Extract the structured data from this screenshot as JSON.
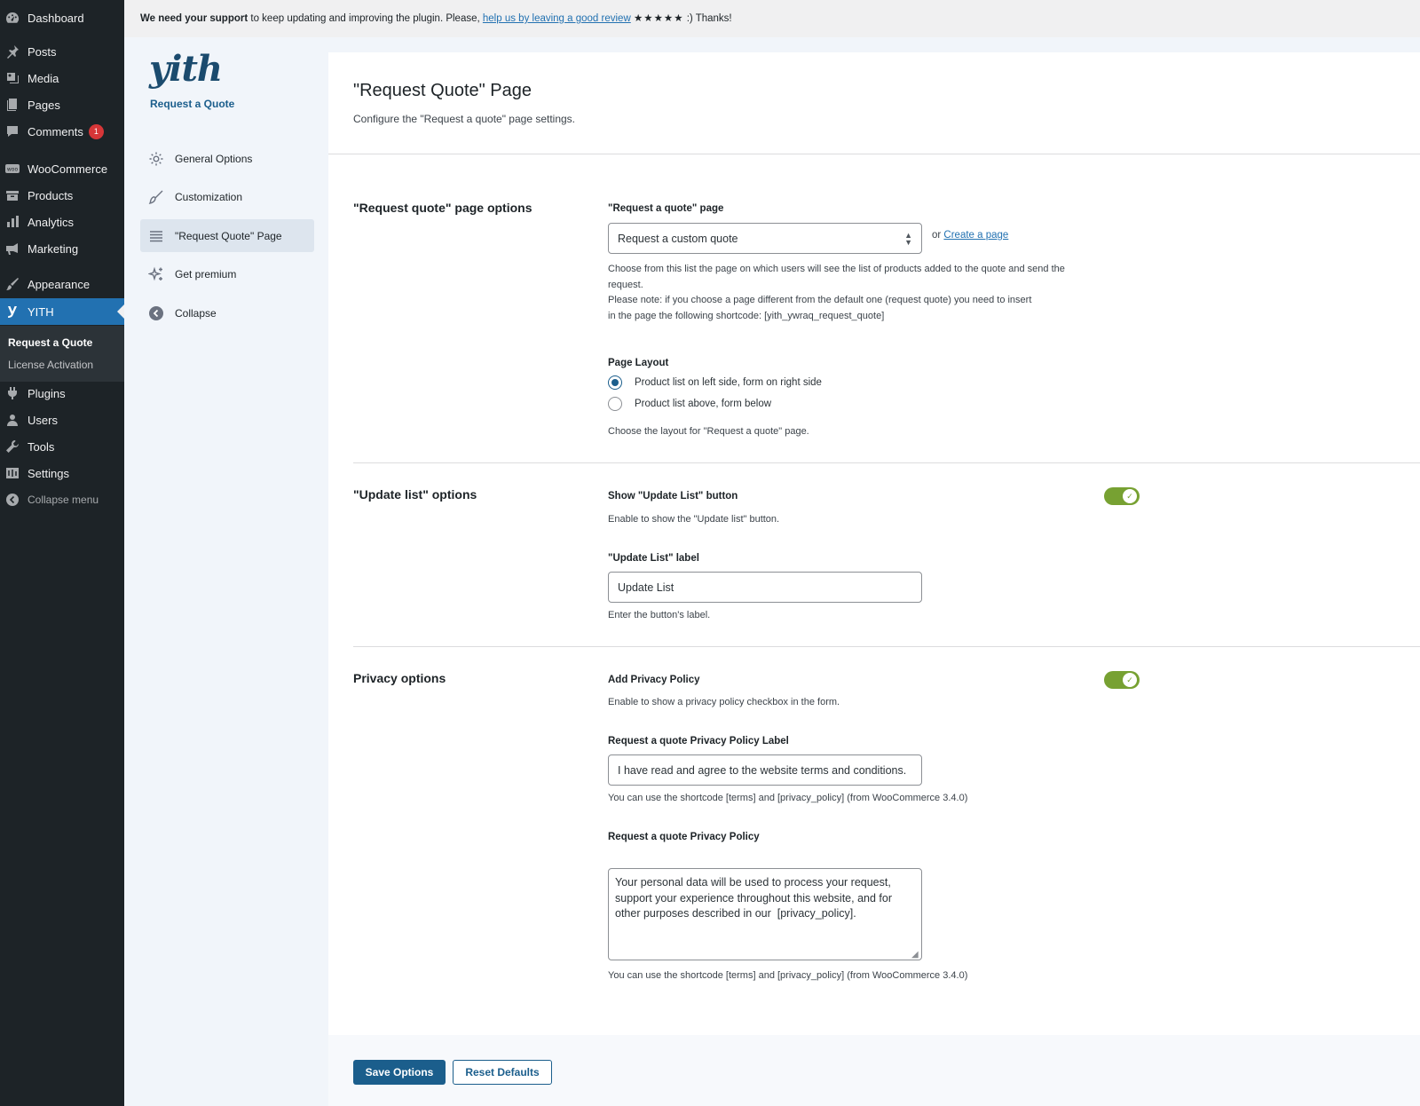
{
  "admin_menu": {
    "items": [
      {
        "label": "Dashboard",
        "icon": "dashboard-icon"
      },
      {
        "label": "Posts",
        "icon": "pin-icon"
      },
      {
        "label": "Media",
        "icon": "media-icon"
      },
      {
        "label": "Pages",
        "icon": "pages-icon"
      },
      {
        "label": "Comments",
        "icon": "comment-icon",
        "badge": "1"
      },
      {
        "label": "WooCommerce",
        "icon": "woocommerce-icon"
      },
      {
        "label": "Products",
        "icon": "archive-icon"
      },
      {
        "label": "Analytics",
        "icon": "bar-chart-icon"
      },
      {
        "label": "Marketing",
        "icon": "megaphone-icon"
      },
      {
        "label": "Appearance",
        "icon": "brush-icon"
      },
      {
        "label": "YITH",
        "icon": "yith-icon",
        "current": true
      },
      {
        "label": "Plugins",
        "icon": "plugin-icon"
      },
      {
        "label": "Users",
        "icon": "user-icon"
      },
      {
        "label": "Tools",
        "icon": "wrench-icon"
      },
      {
        "label": "Settings",
        "icon": "settings-icon"
      },
      {
        "label": "Collapse menu",
        "icon": "collapse-icon"
      }
    ],
    "submenu": [
      {
        "label": "Request a Quote",
        "current": true
      },
      {
        "label": "License Activation"
      }
    ]
  },
  "notice": {
    "bold": "We need your support",
    "text1": " to keep updating and improving the plugin. Please, ",
    "link": "help us by leaving a good review",
    "stars": "★★★★★",
    "text2": " :) Thanks!"
  },
  "plugin": {
    "logo": "yith",
    "name": "Request a Quote",
    "nav": [
      {
        "label": "General Options",
        "icon": "gear-icon"
      },
      {
        "label": "Customization",
        "icon": "brush-icon"
      },
      {
        "label": "\"Request Quote\" Page",
        "icon": "list-icon",
        "active": true
      },
      {
        "label": "Get premium",
        "icon": "sparkle-icon"
      },
      {
        "label": "Collapse",
        "icon": "collapse-icon"
      }
    ]
  },
  "page": {
    "title": "\"Request Quote\" Page",
    "description": "Configure the \"Request a quote\" page settings."
  },
  "sections": {
    "quote_page": {
      "title": "\"Request quote\" page options",
      "page_label": "\"Request a quote\" page",
      "page_selected": "Request a custom quote",
      "or_text": "or ",
      "create_link": "Create a page",
      "page_desc_1": "Choose from this list the page on which users will see the list of products added to the quote and send the",
      "page_desc_2": "request.",
      "page_desc_3": "Please note: if you choose a page different from the default one (request quote) you need to insert",
      "page_desc_4": "in the page the following shortcode: [yith_ywraq_request_quote]",
      "layout_label": "Page Layout",
      "layout_options": [
        {
          "label": "Product list on left side, form on right side",
          "checked": true
        },
        {
          "label": "Product list above, form below",
          "checked": false
        }
      ],
      "layout_desc": "Choose the layout for \"Request a quote\" page."
    },
    "update_list": {
      "title": "\"Update list\" options",
      "show_label": "Show \"Update List\" button",
      "show_enabled": true,
      "show_desc": "Enable to show the \"Update list\" button.",
      "label_label": "\"Update List\" label",
      "label_value": "Update List",
      "label_desc": "Enter the button's label."
    },
    "privacy": {
      "title": "Privacy options",
      "add_label": "Add Privacy Policy",
      "add_enabled": true,
      "add_desc": "Enable to show a privacy policy checkbox in the form.",
      "policy_label_label": "Request a quote Privacy Policy Label",
      "policy_label_value": "I have read and agree to the website terms and conditions.",
      "policy_label_desc": "You can use the shortcode [terms] and [privacy_policy] (from WooCommerce 3.4.0)",
      "policy_label": "Request a quote Privacy Policy",
      "policy_value": "Your personal data will be used to process your request, support your experience throughout this website, and for other purposes described in our  [privacy_policy].",
      "policy_desc": "You can use the shortcode [terms] and [privacy_policy] (from WooCommerce 3.4.0)"
    }
  },
  "actions": {
    "save": "Save Options",
    "reset": "Reset Defaults"
  },
  "colors": {
    "admin_menu_bg": "#1d2327",
    "admin_current": "#2271b1",
    "yith_primary": "#1b5e8c",
    "toggle_on": "#77a132",
    "badge": "#d63638"
  }
}
